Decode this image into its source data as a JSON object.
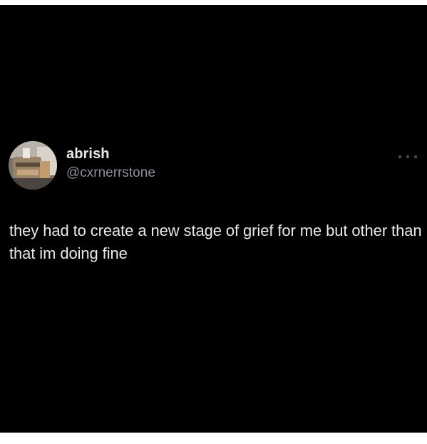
{
  "tweet": {
    "author": {
      "display_name": "abrish",
      "handle": "@cxrnerrstone",
      "avatar_icon": "profile-photo"
    },
    "text": "they had to create a new stage of grief for me but other than that im doing fine",
    "more_icon": "more-options-icon"
  },
  "colors": {
    "background": "#000000",
    "primary_text": "#e7e9ea",
    "secondary_text": "#8b9098"
  }
}
